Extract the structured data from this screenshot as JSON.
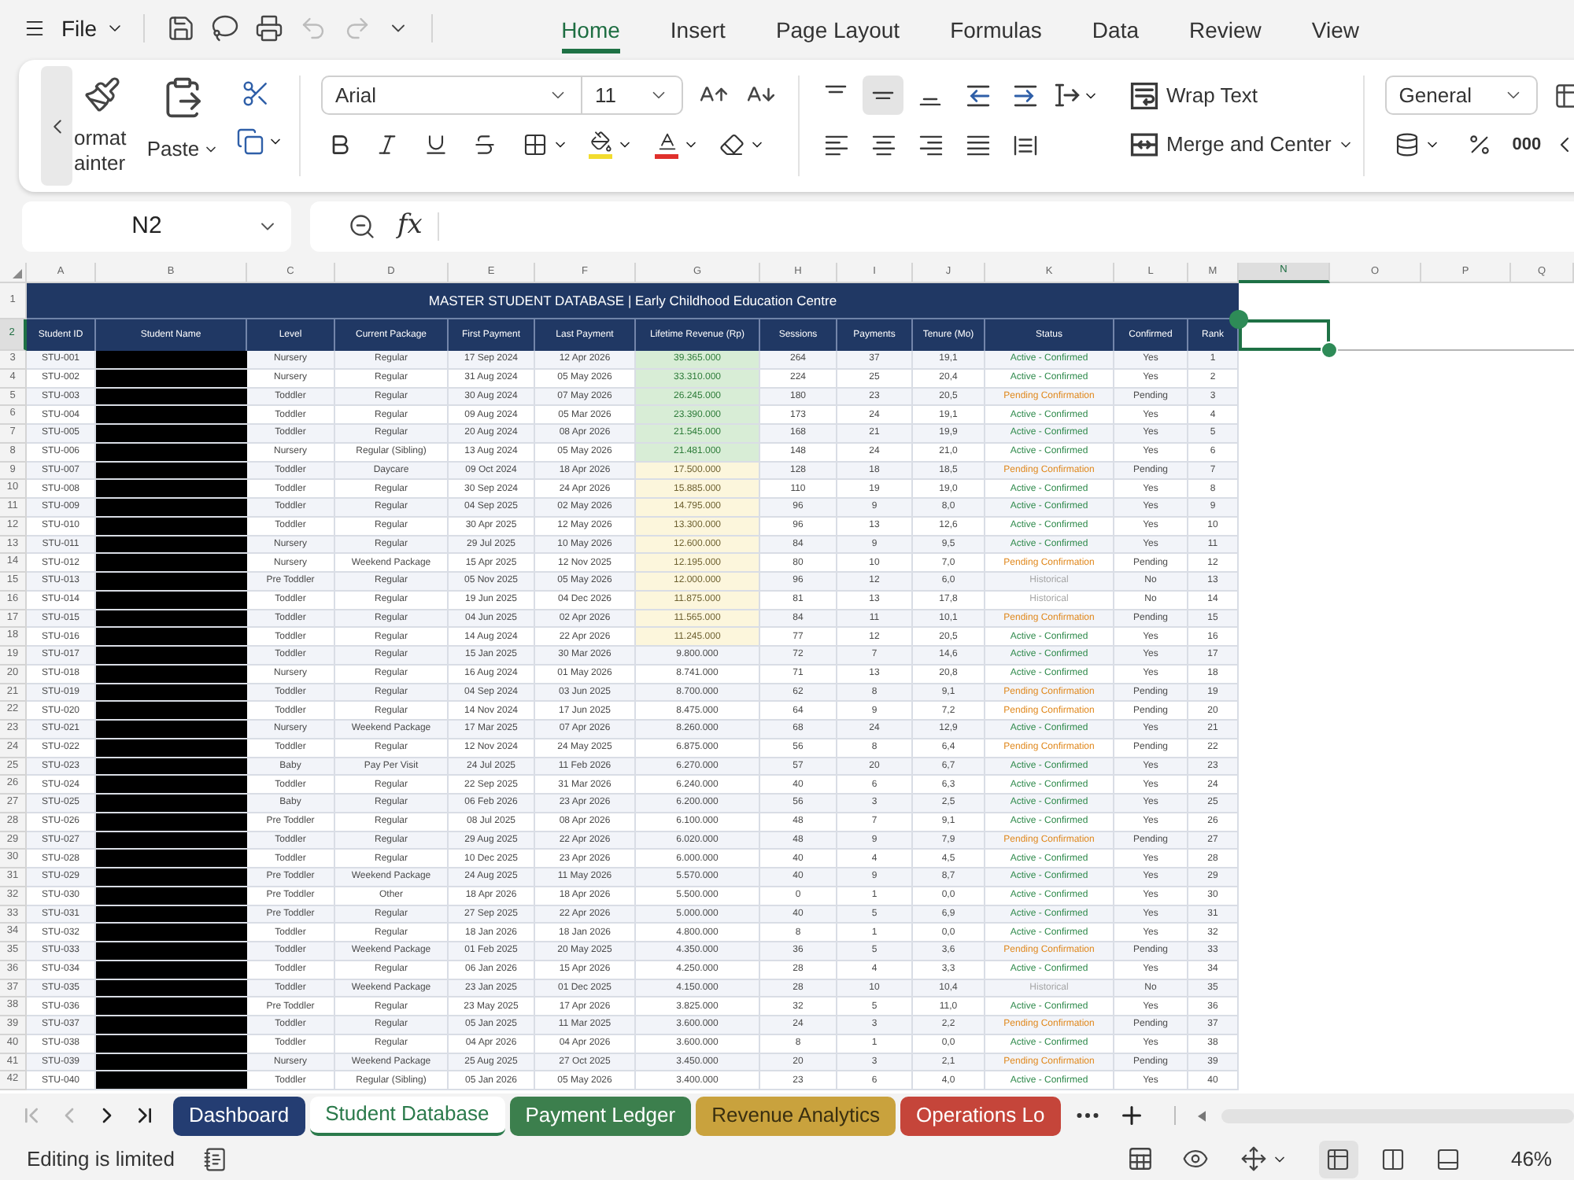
{
  "menu_bar": {
    "file_label": "File",
    "undo": {
      "disabled": true
    },
    "redo": {
      "disabled": true
    },
    "tabs": [
      {
        "label": "Home",
        "selected": true
      },
      {
        "label": "Insert",
        "selected": false
      },
      {
        "label": "Page Layout",
        "selected": false
      },
      {
        "label": "Formulas",
        "selected": false
      },
      {
        "label": "Data",
        "selected": false
      },
      {
        "label": "Review",
        "selected": false
      },
      {
        "label": "View",
        "selected": false
      }
    ]
  },
  "ribbon": {
    "format_painter_lines": [
      "ormat",
      "ainter"
    ],
    "paste_label": "Paste",
    "font_name": "Arial",
    "font_size": "11",
    "fill_swatch": {
      "color": "#f2dc2e"
    },
    "font_swatch": {
      "color": "#e0302c"
    },
    "valign_buttons": [
      {
        "kind": "top",
        "selected": false
      },
      {
        "kind": "middle",
        "selected": true
      },
      {
        "kind": "bottom",
        "selected": false
      }
    ],
    "halign_buttons": [
      {
        "kind": "left",
        "selected": false
      },
      {
        "kind": "center",
        "selected": false
      },
      {
        "kind": "right",
        "selected": false
      },
      {
        "kind": "justify",
        "selected": false
      },
      {
        "kind": "distributed",
        "selected": false
      }
    ],
    "wrap_text_label": "Wrap Text",
    "merge_label": "Merge and Center",
    "number_format": "General",
    "comma_style_label": "000"
  },
  "formula_bar": {
    "name_box": "N2",
    "function_label": "fx"
  },
  "sheet": {
    "column_letters": [
      {
        "label": "A",
        "selected": false
      },
      {
        "label": "B",
        "selected": false
      },
      {
        "label": "C",
        "selected": false
      },
      {
        "label": "D",
        "selected": false
      },
      {
        "label": "E",
        "selected": false
      },
      {
        "label": "F",
        "selected": false
      },
      {
        "label": "G",
        "selected": false
      },
      {
        "label": "H",
        "selected": false
      },
      {
        "label": "I",
        "selected": false
      },
      {
        "label": "J",
        "selected": false
      },
      {
        "label": "K",
        "selected": false
      },
      {
        "label": "L",
        "selected": false
      },
      {
        "label": "M",
        "selected": false
      },
      {
        "label": "N",
        "selected": true
      },
      {
        "label": "O",
        "selected": false
      },
      {
        "label": "P",
        "selected": false
      },
      {
        "label": "Q",
        "selected": false
      }
    ],
    "row_numbers": [
      {
        "label": "1",
        "selected": false
      },
      {
        "label": "2",
        "selected": true
      },
      {
        "label": "3",
        "selected": false
      },
      {
        "label": "4",
        "selected": false
      },
      {
        "label": "5",
        "selected": false
      },
      {
        "label": "6",
        "selected": false
      },
      {
        "label": "7",
        "selected": false
      },
      {
        "label": "8",
        "selected": false
      },
      {
        "label": "9",
        "selected": false
      },
      {
        "label": "10",
        "selected": false
      },
      {
        "label": "11",
        "selected": false
      },
      {
        "label": "12",
        "selected": false
      },
      {
        "label": "13",
        "selected": false
      },
      {
        "label": "14",
        "selected": false
      },
      {
        "label": "15",
        "selected": false
      },
      {
        "label": "16",
        "selected": false
      },
      {
        "label": "17",
        "selected": false
      },
      {
        "label": "18",
        "selected": false
      },
      {
        "label": "19",
        "selected": false
      },
      {
        "label": "20",
        "selected": false
      },
      {
        "label": "21",
        "selected": false
      },
      {
        "label": "22",
        "selected": false
      },
      {
        "label": "23",
        "selected": false
      },
      {
        "label": "24",
        "selected": false
      },
      {
        "label": "25",
        "selected": false
      },
      {
        "label": "26",
        "selected": false
      },
      {
        "label": "27",
        "selected": false
      },
      {
        "label": "28",
        "selected": false
      },
      {
        "label": "29",
        "selected": false
      },
      {
        "label": "30",
        "selected": false
      },
      {
        "label": "31",
        "selected": false
      },
      {
        "label": "32",
        "selected": false
      },
      {
        "label": "33",
        "selected": false
      },
      {
        "label": "34",
        "selected": false
      },
      {
        "label": "35",
        "selected": false
      },
      {
        "label": "36",
        "selected": false
      },
      {
        "label": "37",
        "selected": false
      },
      {
        "label": "38",
        "selected": false
      },
      {
        "label": "39",
        "selected": false
      },
      {
        "label": "40",
        "selected": false
      },
      {
        "label": "41",
        "selected": false
      },
      {
        "label": "42",
        "selected": false
      }
    ],
    "title": "MASTER STUDENT DATABASE | Early Childhood Education Centre",
    "columns": [
      "Student ID",
      "Student Name",
      "Level",
      "Current Package",
      "First Payment",
      "Last Payment",
      "Lifetime Revenue (Rp)",
      "Sessions",
      "Payments",
      "Tenure (Mo)",
      "Status",
      "Confirmed",
      "Rank"
    ],
    "rows": [
      {
        "id": "STU-001",
        "name_hidden": true,
        "level": "Nursery",
        "package": "Regular",
        "first_payment": "17 Sep 2024",
        "last_payment": "12 Apr 2026",
        "revenue": {
          "text": "39.365.000",
          "kind": "high"
        },
        "sessions": "264",
        "payments": "37",
        "tenure": "19,1",
        "status": {
          "text": "Active - Confirmed",
          "kind": "active"
        },
        "confirmed": "Yes",
        "rank": "1"
      },
      {
        "id": "STU-002",
        "name_hidden": true,
        "level": "Nursery",
        "package": "Regular",
        "first_payment": "31 Aug 2024",
        "last_payment": "05 May 2026",
        "revenue": {
          "text": "33.310.000",
          "kind": "high"
        },
        "sessions": "224",
        "payments": "25",
        "tenure": "20,4",
        "status": {
          "text": "Active - Confirmed",
          "kind": "active"
        },
        "confirmed": "Yes",
        "rank": "2"
      },
      {
        "id": "STU-003",
        "name_hidden": true,
        "level": "Toddler",
        "package": "Regular",
        "first_payment": "30 Aug 2024",
        "last_payment": "07 May 2026",
        "revenue": {
          "text": "26.245.000",
          "kind": "high"
        },
        "sessions": "180",
        "payments": "23",
        "tenure": "20,5",
        "status": {
          "text": "Pending Confirmation",
          "kind": "pending"
        },
        "confirmed": "Pending",
        "rank": "3"
      },
      {
        "id": "STU-004",
        "name_hidden": true,
        "level": "Toddler",
        "package": "Regular",
        "first_payment": "09 Aug 2024",
        "last_payment": "05 Mar 2026",
        "revenue": {
          "text": "23.390.000",
          "kind": "high"
        },
        "sessions": "173",
        "payments": "24",
        "tenure": "19,1",
        "status": {
          "text": "Active - Confirmed",
          "kind": "active"
        },
        "confirmed": "Yes",
        "rank": "4"
      },
      {
        "id": "STU-005",
        "name_hidden": true,
        "level": "Toddler",
        "package": "Regular",
        "first_payment": "20 Aug 2024",
        "last_payment": "08 Apr 2026",
        "revenue": {
          "text": "21.545.000",
          "kind": "high"
        },
        "sessions": "168",
        "payments": "21",
        "tenure": "19,9",
        "status": {
          "text": "Active - Confirmed",
          "kind": "active"
        },
        "confirmed": "Yes",
        "rank": "5"
      },
      {
        "id": "STU-006",
        "name_hidden": true,
        "level": "Nursery",
        "package": "Regular (Sibling)",
        "first_payment": "13 Aug 2024",
        "last_payment": "05 May 2026",
        "revenue": {
          "text": "21.481.000",
          "kind": "high"
        },
        "sessions": "148",
        "payments": "24",
        "tenure": "21,0",
        "status": {
          "text": "Active - Confirmed",
          "kind": "active"
        },
        "confirmed": "Yes",
        "rank": "6"
      },
      {
        "id": "STU-007",
        "name_hidden": true,
        "level": "Toddler",
        "package": "Daycare",
        "first_payment": "09 Oct 2024",
        "last_payment": "18 Apr 2026",
        "revenue": {
          "text": "17.500.000",
          "kind": "mid"
        },
        "sessions": "128",
        "payments": "18",
        "tenure": "18,5",
        "status": {
          "text": "Pending Confirmation",
          "kind": "pending"
        },
        "confirmed": "Pending",
        "rank": "7"
      },
      {
        "id": "STU-008",
        "name_hidden": true,
        "level": "Toddler",
        "package": "Regular",
        "first_payment": "30 Sep 2024",
        "last_payment": "24 Apr 2026",
        "revenue": {
          "text": "15.885.000",
          "kind": "mid"
        },
        "sessions": "110",
        "payments": "19",
        "tenure": "19,0",
        "status": {
          "text": "Active - Confirmed",
          "kind": "active"
        },
        "confirmed": "Yes",
        "rank": "8"
      },
      {
        "id": "STU-009",
        "name_hidden": true,
        "level": "Toddler",
        "package": "Regular",
        "first_payment": "04 Sep 2025",
        "last_payment": "02 May 2026",
        "revenue": {
          "text": "14.795.000",
          "kind": "mid"
        },
        "sessions": "96",
        "payments": "9",
        "tenure": "8,0",
        "status": {
          "text": "Active - Confirmed",
          "kind": "active"
        },
        "confirmed": "Yes",
        "rank": "9"
      },
      {
        "id": "STU-010",
        "name_hidden": true,
        "level": "Toddler",
        "package": "Regular",
        "first_payment": "30 Apr 2025",
        "last_payment": "12 May 2026",
        "revenue": {
          "text": "13.300.000",
          "kind": "mid"
        },
        "sessions": "96",
        "payments": "13",
        "tenure": "12,6",
        "status": {
          "text": "Active - Confirmed",
          "kind": "active"
        },
        "confirmed": "Yes",
        "rank": "10"
      },
      {
        "id": "STU-011",
        "name_hidden": true,
        "level": "Nursery",
        "package": "Regular",
        "first_payment": "29 Jul 2025",
        "last_payment": "10 May 2026",
        "revenue": {
          "text": "12.600.000",
          "kind": "mid"
        },
        "sessions": "84",
        "payments": "9",
        "tenure": "9,5",
        "status": {
          "text": "Active - Confirmed",
          "kind": "active"
        },
        "confirmed": "Yes",
        "rank": "11"
      },
      {
        "id": "STU-012",
        "name_hidden": true,
        "level": "Nursery",
        "package": "Weekend Package",
        "first_payment": "15 Apr 2025",
        "last_payment": "12 Nov 2025",
        "revenue": {
          "text": "12.195.000",
          "kind": "mid"
        },
        "sessions": "80",
        "payments": "10",
        "tenure": "7,0",
        "status": {
          "text": "Pending Confirmation",
          "kind": "pending"
        },
        "confirmed": "Pending",
        "rank": "12"
      },
      {
        "id": "STU-013",
        "name_hidden": true,
        "level": "Pre Toddler",
        "package": "Regular",
        "first_payment": "05 Nov 2025",
        "last_payment": "05 May 2026",
        "revenue": {
          "text": "12.000.000",
          "kind": "mid"
        },
        "sessions": "96",
        "payments": "12",
        "tenure": "6,0",
        "status": {
          "text": "Historical",
          "kind": "historical"
        },
        "confirmed": "No",
        "rank": "13"
      },
      {
        "id": "STU-014",
        "name_hidden": true,
        "level": "Toddler",
        "package": "Regular",
        "first_payment": "19 Jun 2025",
        "last_payment": "04 Dec 2026",
        "revenue": {
          "text": "11.875.000",
          "kind": "mid"
        },
        "sessions": "81",
        "payments": "13",
        "tenure": "17,8",
        "status": {
          "text": "Historical",
          "kind": "historical"
        },
        "confirmed": "No",
        "rank": "14"
      },
      {
        "id": "STU-015",
        "name_hidden": true,
        "level": "Toddler",
        "package": "Regular",
        "first_payment": "04 Jun 2025",
        "last_payment": "02 Apr 2026",
        "revenue": {
          "text": "11.565.000",
          "kind": "mid"
        },
        "sessions": "84",
        "payments": "11",
        "tenure": "10,1",
        "status": {
          "text": "Pending Confirmation",
          "kind": "pending"
        },
        "confirmed": "Pending",
        "rank": "15"
      },
      {
        "id": "STU-016",
        "name_hidden": true,
        "level": "Toddler",
        "package": "Regular",
        "first_payment": "14 Aug 2024",
        "last_payment": "22 Apr 2026",
        "revenue": {
          "text": "11.245.000",
          "kind": "mid"
        },
        "sessions": "77",
        "payments": "12",
        "tenure": "20,5",
        "status": {
          "text": "Active - Confirmed",
          "kind": "active"
        },
        "confirmed": "Yes",
        "rank": "16"
      },
      {
        "id": "STU-017",
        "name_hidden": true,
        "level": "Toddler",
        "package": "Regular",
        "first_payment": "15 Jan 2025",
        "last_payment": "30 Mar 2026",
        "revenue": {
          "text": "9.800.000",
          "kind": "low"
        },
        "sessions": "72",
        "payments": "7",
        "tenure": "14,6",
        "status": {
          "text": "Active - Confirmed",
          "kind": "active"
        },
        "confirmed": "Yes",
        "rank": "17"
      },
      {
        "id": "STU-018",
        "name_hidden": true,
        "level": "Nursery",
        "package": "Regular",
        "first_payment": "16 Aug 2024",
        "last_payment": "01 May 2026",
        "revenue": {
          "text": "8.741.000",
          "kind": "low"
        },
        "sessions": "71",
        "payments": "13",
        "tenure": "20,8",
        "status": {
          "text": "Active - Confirmed",
          "kind": "active"
        },
        "confirmed": "Yes",
        "rank": "18"
      },
      {
        "id": "STU-019",
        "name_hidden": true,
        "level": "Toddler",
        "package": "Regular",
        "first_payment": "04 Sep 2024",
        "last_payment": "03 Jun 2025",
        "revenue": {
          "text": "8.700.000",
          "kind": "low"
        },
        "sessions": "62",
        "payments": "8",
        "tenure": "9,1",
        "status": {
          "text": "Pending Confirmation",
          "kind": "pending"
        },
        "confirmed": "Pending",
        "rank": "19"
      },
      {
        "id": "STU-020",
        "name_hidden": true,
        "level": "Toddler",
        "package": "Regular",
        "first_payment": "14 Nov 2024",
        "last_payment": "17 Jun 2025",
        "revenue": {
          "text": "8.475.000",
          "kind": "low"
        },
        "sessions": "64",
        "payments": "9",
        "tenure": "7,2",
        "status": {
          "text": "Pending Confirmation",
          "kind": "pending"
        },
        "confirmed": "Pending",
        "rank": "20"
      },
      {
        "id": "STU-021",
        "name_hidden": true,
        "level": "Nursery",
        "package": "Weekend Package",
        "first_payment": "17 Mar 2025",
        "last_payment": "07 Apr 2026",
        "revenue": {
          "text": "8.260.000",
          "kind": "low"
        },
        "sessions": "68",
        "payments": "24",
        "tenure": "12,9",
        "status": {
          "text": "Active - Confirmed",
          "kind": "active"
        },
        "confirmed": "Yes",
        "rank": "21"
      },
      {
        "id": "STU-022",
        "name_hidden": true,
        "level": "Toddler",
        "package": "Regular",
        "first_payment": "12 Nov 2024",
        "last_payment": "24 May 2025",
        "revenue": {
          "text": "6.875.000",
          "kind": "low"
        },
        "sessions": "56",
        "payments": "8",
        "tenure": "6,4",
        "status": {
          "text": "Pending Confirmation",
          "kind": "pending"
        },
        "confirmed": "Pending",
        "rank": "22"
      },
      {
        "id": "STU-023",
        "name_hidden": true,
        "level": "Baby",
        "package": "Pay Per Visit",
        "first_payment": "24 Jul 2025",
        "last_payment": "11 Feb 2026",
        "revenue": {
          "text": "6.270.000",
          "kind": "low"
        },
        "sessions": "57",
        "payments": "20",
        "tenure": "6,7",
        "status": {
          "text": "Active - Confirmed",
          "kind": "active"
        },
        "confirmed": "Yes",
        "rank": "23"
      },
      {
        "id": "STU-024",
        "name_hidden": true,
        "level": "Toddler",
        "package": "Regular",
        "first_payment": "22 Sep 2025",
        "last_payment": "31 Mar 2026",
        "revenue": {
          "text": "6.240.000",
          "kind": "low"
        },
        "sessions": "40",
        "payments": "6",
        "tenure": "6,3",
        "status": {
          "text": "Active - Confirmed",
          "kind": "active"
        },
        "confirmed": "Yes",
        "rank": "24"
      },
      {
        "id": "STU-025",
        "name_hidden": true,
        "level": "Baby",
        "package": "Regular",
        "first_payment": "06 Feb 2026",
        "last_payment": "23 Apr 2026",
        "revenue": {
          "text": "6.200.000",
          "kind": "low"
        },
        "sessions": "56",
        "payments": "3",
        "tenure": "2,5",
        "status": {
          "text": "Active - Confirmed",
          "kind": "active"
        },
        "confirmed": "Yes",
        "rank": "25"
      },
      {
        "id": "STU-026",
        "name_hidden": true,
        "level": "Pre Toddler",
        "package": "Regular",
        "first_payment": "08 Jul 2025",
        "last_payment": "08 Apr 2026",
        "revenue": {
          "text": "6.100.000",
          "kind": "low"
        },
        "sessions": "48",
        "payments": "7",
        "tenure": "9,1",
        "status": {
          "text": "Active - Confirmed",
          "kind": "active"
        },
        "confirmed": "Yes",
        "rank": "26"
      },
      {
        "id": "STU-027",
        "name_hidden": true,
        "level": "Toddler",
        "package": "Regular",
        "first_payment": "29 Aug 2025",
        "last_payment": "22 Apr 2026",
        "revenue": {
          "text": "6.020.000",
          "kind": "low"
        },
        "sessions": "48",
        "payments": "9",
        "tenure": "7,9",
        "status": {
          "text": "Pending Confirmation",
          "kind": "pending"
        },
        "confirmed": "Pending",
        "rank": "27"
      },
      {
        "id": "STU-028",
        "name_hidden": true,
        "level": "Toddler",
        "package": "Regular",
        "first_payment": "10 Dec 2025",
        "last_payment": "23 Apr 2026",
        "revenue": {
          "text": "6.000.000",
          "kind": "low"
        },
        "sessions": "40",
        "payments": "4",
        "tenure": "4,5",
        "status": {
          "text": "Active - Confirmed",
          "kind": "active"
        },
        "confirmed": "Yes",
        "rank": "28"
      },
      {
        "id": "STU-029",
        "name_hidden": true,
        "level": "Pre Toddler",
        "package": "Weekend Package",
        "first_payment": "24 Aug 2025",
        "last_payment": "11 May 2026",
        "revenue": {
          "text": "5.570.000",
          "kind": "low"
        },
        "sessions": "40",
        "payments": "9",
        "tenure": "8,7",
        "status": {
          "text": "Active - Confirmed",
          "kind": "active"
        },
        "confirmed": "Yes",
        "rank": "29"
      },
      {
        "id": "STU-030",
        "name_hidden": true,
        "level": "Pre Toddler",
        "package": "Other",
        "first_payment": "18 Apr 2026",
        "last_payment": "18 Apr 2026",
        "revenue": {
          "text": "5.500.000",
          "kind": "low"
        },
        "sessions": "0",
        "payments": "1",
        "tenure": "0,0",
        "status": {
          "text": "Active - Confirmed",
          "kind": "active"
        },
        "confirmed": "Yes",
        "rank": "30"
      },
      {
        "id": "STU-031",
        "name_hidden": true,
        "level": "Pre Toddler",
        "package": "Regular",
        "first_payment": "27 Sep 2025",
        "last_payment": "22 Apr 2026",
        "revenue": {
          "text": "5.000.000",
          "kind": "low"
        },
        "sessions": "40",
        "payments": "5",
        "tenure": "6,9",
        "status": {
          "text": "Active - Confirmed",
          "kind": "active"
        },
        "confirmed": "Yes",
        "rank": "31"
      },
      {
        "id": "STU-032",
        "name_hidden": true,
        "level": "Toddler",
        "package": "Regular",
        "first_payment": "18 Jan 2026",
        "last_payment": "18 Jan 2026",
        "revenue": {
          "text": "4.800.000",
          "kind": "low"
        },
        "sessions": "8",
        "payments": "1",
        "tenure": "0,0",
        "status": {
          "text": "Active - Confirmed",
          "kind": "active"
        },
        "confirmed": "Yes",
        "rank": "32"
      },
      {
        "id": "STU-033",
        "name_hidden": true,
        "level": "Toddler",
        "package": "Weekend Package",
        "first_payment": "01 Feb 2025",
        "last_payment": "20 May 2025",
        "revenue": {
          "text": "4.350.000",
          "kind": "low"
        },
        "sessions": "36",
        "payments": "5",
        "tenure": "3,6",
        "status": {
          "text": "Pending Confirmation",
          "kind": "pending"
        },
        "confirmed": "Pending",
        "rank": "33"
      },
      {
        "id": "STU-034",
        "name_hidden": true,
        "level": "Toddler",
        "package": "Regular",
        "first_payment": "06 Jan 2026",
        "last_payment": "15 Apr 2026",
        "revenue": {
          "text": "4.250.000",
          "kind": "low"
        },
        "sessions": "28",
        "payments": "4",
        "tenure": "3,3",
        "status": {
          "text": "Active - Confirmed",
          "kind": "active"
        },
        "confirmed": "Yes",
        "rank": "34"
      },
      {
        "id": "STU-035",
        "name_hidden": true,
        "level": "Toddler",
        "package": "Weekend Package",
        "first_payment": "23 Jan 2025",
        "last_payment": "01 Dec 2025",
        "revenue": {
          "text": "4.150.000",
          "kind": "low"
        },
        "sessions": "28",
        "payments": "10",
        "tenure": "10,4",
        "status": {
          "text": "Historical",
          "kind": "historical"
        },
        "confirmed": "No",
        "rank": "35"
      },
      {
        "id": "STU-036",
        "name_hidden": true,
        "level": "Pre Toddler",
        "package": "Regular",
        "first_payment": "23 May 2025",
        "last_payment": "17 Apr 2026",
        "revenue": {
          "text": "3.825.000",
          "kind": "low"
        },
        "sessions": "32",
        "payments": "5",
        "tenure": "11,0",
        "status": {
          "text": "Active - Confirmed",
          "kind": "active"
        },
        "confirmed": "Yes",
        "rank": "36"
      },
      {
        "id": "STU-037",
        "name_hidden": true,
        "level": "Toddler",
        "package": "Regular",
        "first_payment": "05 Jan 2025",
        "last_payment": "11 Mar 2025",
        "revenue": {
          "text": "3.600.000",
          "kind": "low"
        },
        "sessions": "24",
        "payments": "3",
        "tenure": "2,2",
        "status": {
          "text": "Pending Confirmation",
          "kind": "pending"
        },
        "confirmed": "Pending",
        "rank": "37"
      },
      {
        "id": "STU-038",
        "name_hidden": true,
        "level": "Toddler",
        "package": "Regular",
        "first_payment": "04 Apr 2026",
        "last_payment": "04 Apr 2026",
        "revenue": {
          "text": "3.600.000",
          "kind": "low"
        },
        "sessions": "8",
        "payments": "1",
        "tenure": "0,0",
        "status": {
          "text": "Active - Confirmed",
          "kind": "active"
        },
        "confirmed": "Yes",
        "rank": "38"
      },
      {
        "id": "STU-039",
        "name_hidden": true,
        "level": "Nursery",
        "package": "Weekend Package",
        "first_payment": "25 Aug 2025",
        "last_payment": "27 Oct 2025",
        "revenue": {
          "text": "3.450.000",
          "kind": "low"
        },
        "sessions": "20",
        "payments": "3",
        "tenure": "2,1",
        "status": {
          "text": "Pending Confirmation",
          "kind": "pending"
        },
        "confirmed": "Pending",
        "rank": "39"
      },
      {
        "id": "STU-040",
        "name_hidden": true,
        "level": "Toddler",
        "package": "Regular (Sibling)",
        "first_payment": "05 Jan 2026",
        "last_payment": "05 May 2026",
        "revenue": {
          "text": "3.400.000",
          "kind": "low"
        },
        "sessions": "23",
        "payments": "6",
        "tenure": "4,0",
        "status": {
          "text": "Active - Confirmed",
          "kind": "active"
        },
        "confirmed": "Yes",
        "rank": "40"
      }
    ]
  },
  "sheet_tabs_bar": {
    "nav_buttons": [
      {
        "kind": "first",
        "disabled": true
      },
      {
        "kind": "previous",
        "disabled": true
      },
      {
        "kind": "next",
        "disabled": false
      },
      {
        "kind": "last",
        "disabled": false
      }
    ],
    "tabs": [
      {
        "label": "Dashboard",
        "selected": false,
        "color": "#243d72"
      },
      {
        "label": "Student Database",
        "selected": true,
        "color": "#2b7a4b"
      },
      {
        "label": "Payment Ledger",
        "selected": false,
        "color": "#3c7f4d"
      },
      {
        "label": "Revenue Analytics",
        "selected": false,
        "color": "#c9a23d"
      },
      {
        "label": "Operations Lo",
        "selected": false,
        "color": "#c5453a"
      }
    ]
  },
  "status_bar": {
    "text": "Editing is limited",
    "view_buttons": [
      {
        "kind": "normal",
        "selected": true
      },
      {
        "kind": "page_break",
        "selected": false
      },
      {
        "kind": "page_layout",
        "selected": false
      }
    ],
    "zoom": "46%"
  }
}
